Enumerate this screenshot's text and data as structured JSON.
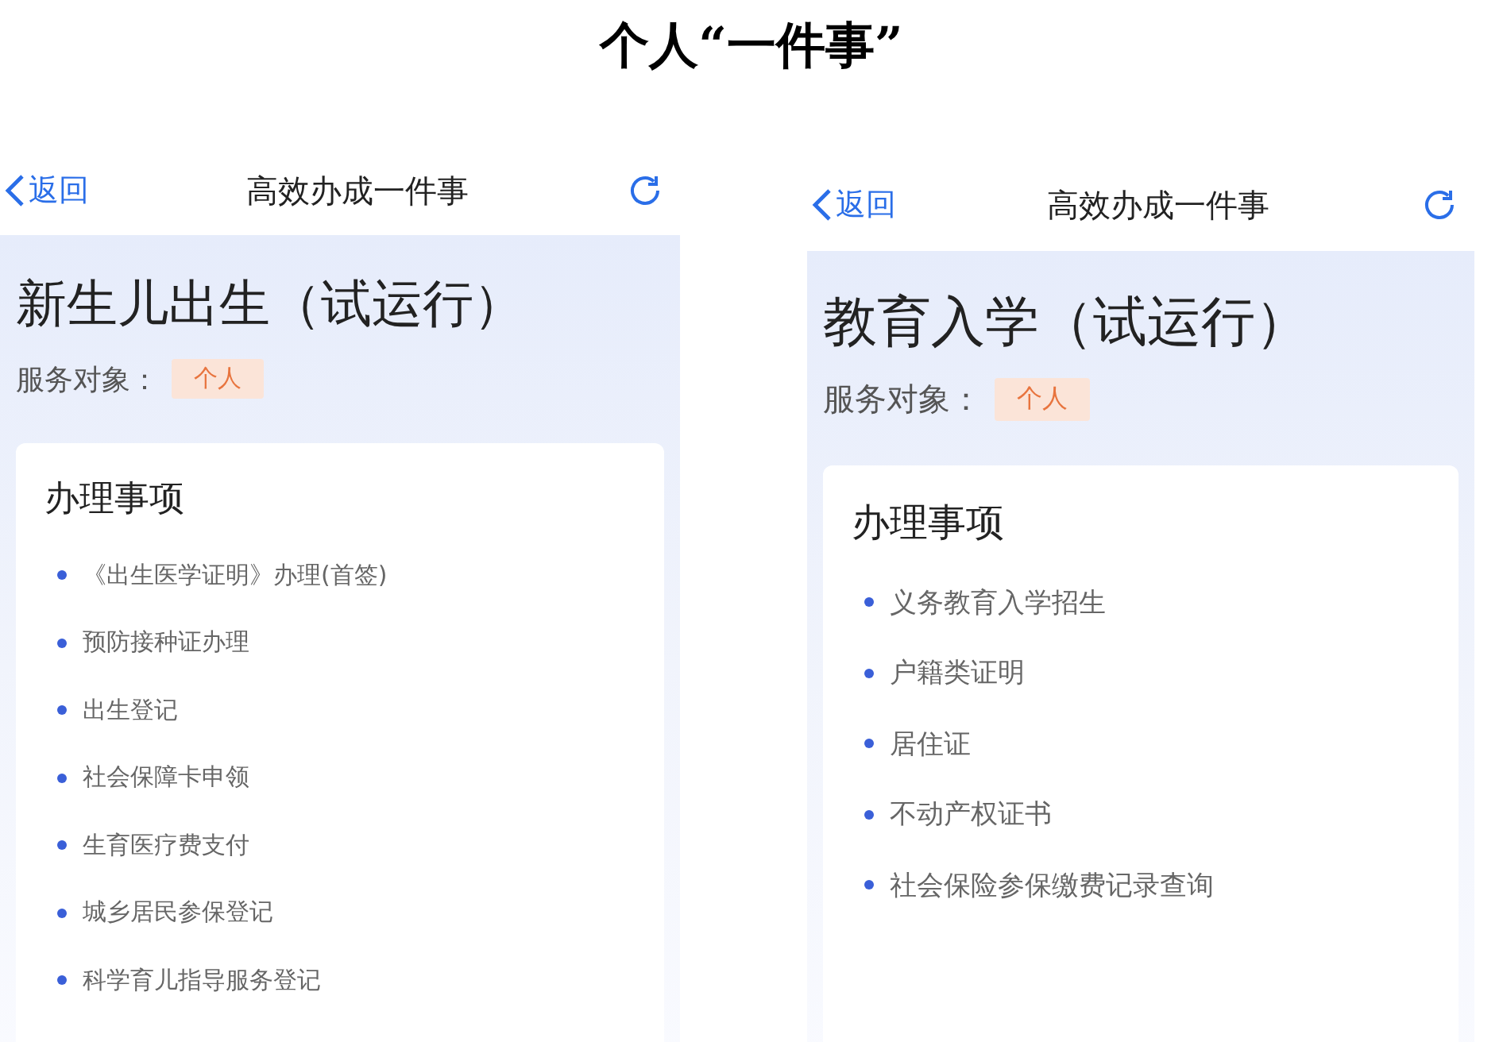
{
  "title": "个人“一件事”",
  "panels": [
    {
      "header": {
        "back": "返回",
        "title": "高效办成一件事"
      },
      "service": {
        "name": "新生儿出生（试运行）",
        "target_label": "服务对象：",
        "target": "个人"
      },
      "card": {
        "heading": "办理事项",
        "items": [
          "《出生医学证明》办理(首签)",
          "预防接种证办理",
          "出生登记",
          "社会保障卡申领",
          "生育医疗费支付",
          "城乡居民参保登记",
          "科学育儿指导服务登记"
        ]
      }
    },
    {
      "header": {
        "back": "返回",
        "title": "高效办成一件事"
      },
      "service": {
        "name": "教育入学（试运行）",
        "target_label": "服务对象：",
        "target": "个人"
      },
      "card": {
        "heading": "办理事项",
        "items": [
          "义务教育入学招生",
          "户籍类证明",
          "居住证",
          "不动产权证书",
          "社会保险参保缴费记录查询"
        ]
      }
    }
  ]
}
